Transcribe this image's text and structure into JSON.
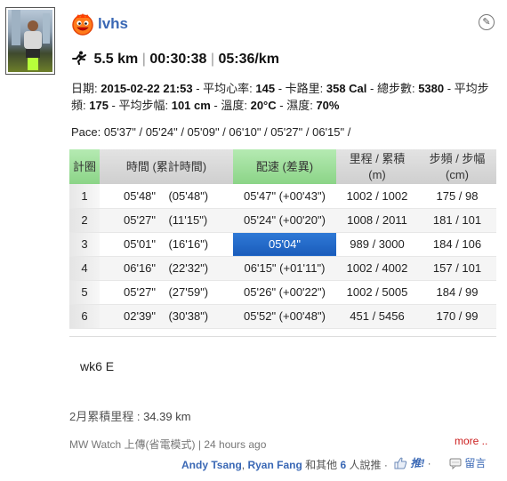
{
  "user": {
    "name": "lvhs"
  },
  "summary": {
    "distance": "5.5 km",
    "duration": "00:30:38",
    "pace": "05:36/km",
    "sep": "|"
  },
  "details": {
    "date_label": "日期: ",
    "date_value": "2015-02-22 21:53",
    "hr_label": " - 平均心率: ",
    "hr_value": "145",
    "cal_label": " - 卡路里: ",
    "cal_value": "358 Cal",
    "steps_label": " - 總步數: ",
    "steps_value": "5380",
    "cadence_label": " - 平均步頻: ",
    "cadence_value": "175",
    "stride_label": " - 平均步幅: ",
    "stride_value": "101 cm",
    "temp_label": " - 溫度: ",
    "temp_value": "20°C",
    "humidity_label": " - 濕度: ",
    "humidity_value": "70%"
  },
  "pace_line": "Pace: 05'37\" / 05'24\" / 05'09\" / 06'10\" / 05'27\" / 06'15\" /",
  "table": {
    "headers": {
      "lap": "計圈",
      "time": "時間 (累計時間)",
      "pace": "配速 (差異)",
      "distance_1": "里程 / 累積",
      "distance_2": "(m)",
      "cadence_1": "步頻 / 步幅",
      "cadence_2": "(cm)"
    },
    "rows": [
      {
        "lap": "1",
        "time": "05'48\"    (05'48\")",
        "pace": "05'47\" (+00'43\")",
        "distance": "1002 / 1002",
        "cadence": "175 / 98"
      },
      {
        "lap": "2",
        "time": "05'27\"    (11'15\")",
        "pace": "05'24\" (+00'20\")",
        "distance": "1008 / 2011",
        "cadence": "181 / 101"
      },
      {
        "lap": "3",
        "time": "05'01\"    (16'16\")",
        "pace": "05'04\"",
        "distance": "989 / 3000",
        "cadence": "184 / 106"
      },
      {
        "lap": "4",
        "time": "06'16\"    (22'32\")",
        "pace": "06'15\" (+01'11\")",
        "distance": "1002 / 4002",
        "cadence": "157 / 101"
      },
      {
        "lap": "5",
        "time": "05'27\"    (27'59\")",
        "pace": "05'26\" (+00'22\")",
        "distance": "1002 / 5005",
        "cadence": "184 / 99"
      },
      {
        "lap": "6",
        "time": "02'39\"    (30'38\")",
        "pace": "05'52\" (+00'48\")",
        "distance": "451 / 5456",
        "cadence": "170 / 99"
      }
    ],
    "highlight_color": "#1f63c4"
  },
  "note": "wk6 E",
  "monthly": {
    "label": "2月累積里程 : ",
    "value": "34.39 km"
  },
  "meta": {
    "source": "MW Watch 上傳(省電模式)",
    "sep": " | ",
    "time": "24 hours ago",
    "more": "more .."
  },
  "social": {
    "name1": "Andy Tsang",
    "comma": ", ",
    "name2": "Ryan Fang",
    "and_others": " 和其他 ",
    "count": "6",
    "suffix": " 人說推 ·",
    "like_label": "推!",
    "dot": " ·",
    "comment_label": "留言"
  },
  "icons": {
    "logo": "smiley-logo-icon",
    "edit": "pencil-icon",
    "run": "runner-icon",
    "like": "thumbs-up-icon",
    "comment": "speech-bubble-icon"
  },
  "colors": {
    "accent": "#3a68b5",
    "header_green": "#9edc9a",
    "more_red": "#cc1f1f"
  }
}
